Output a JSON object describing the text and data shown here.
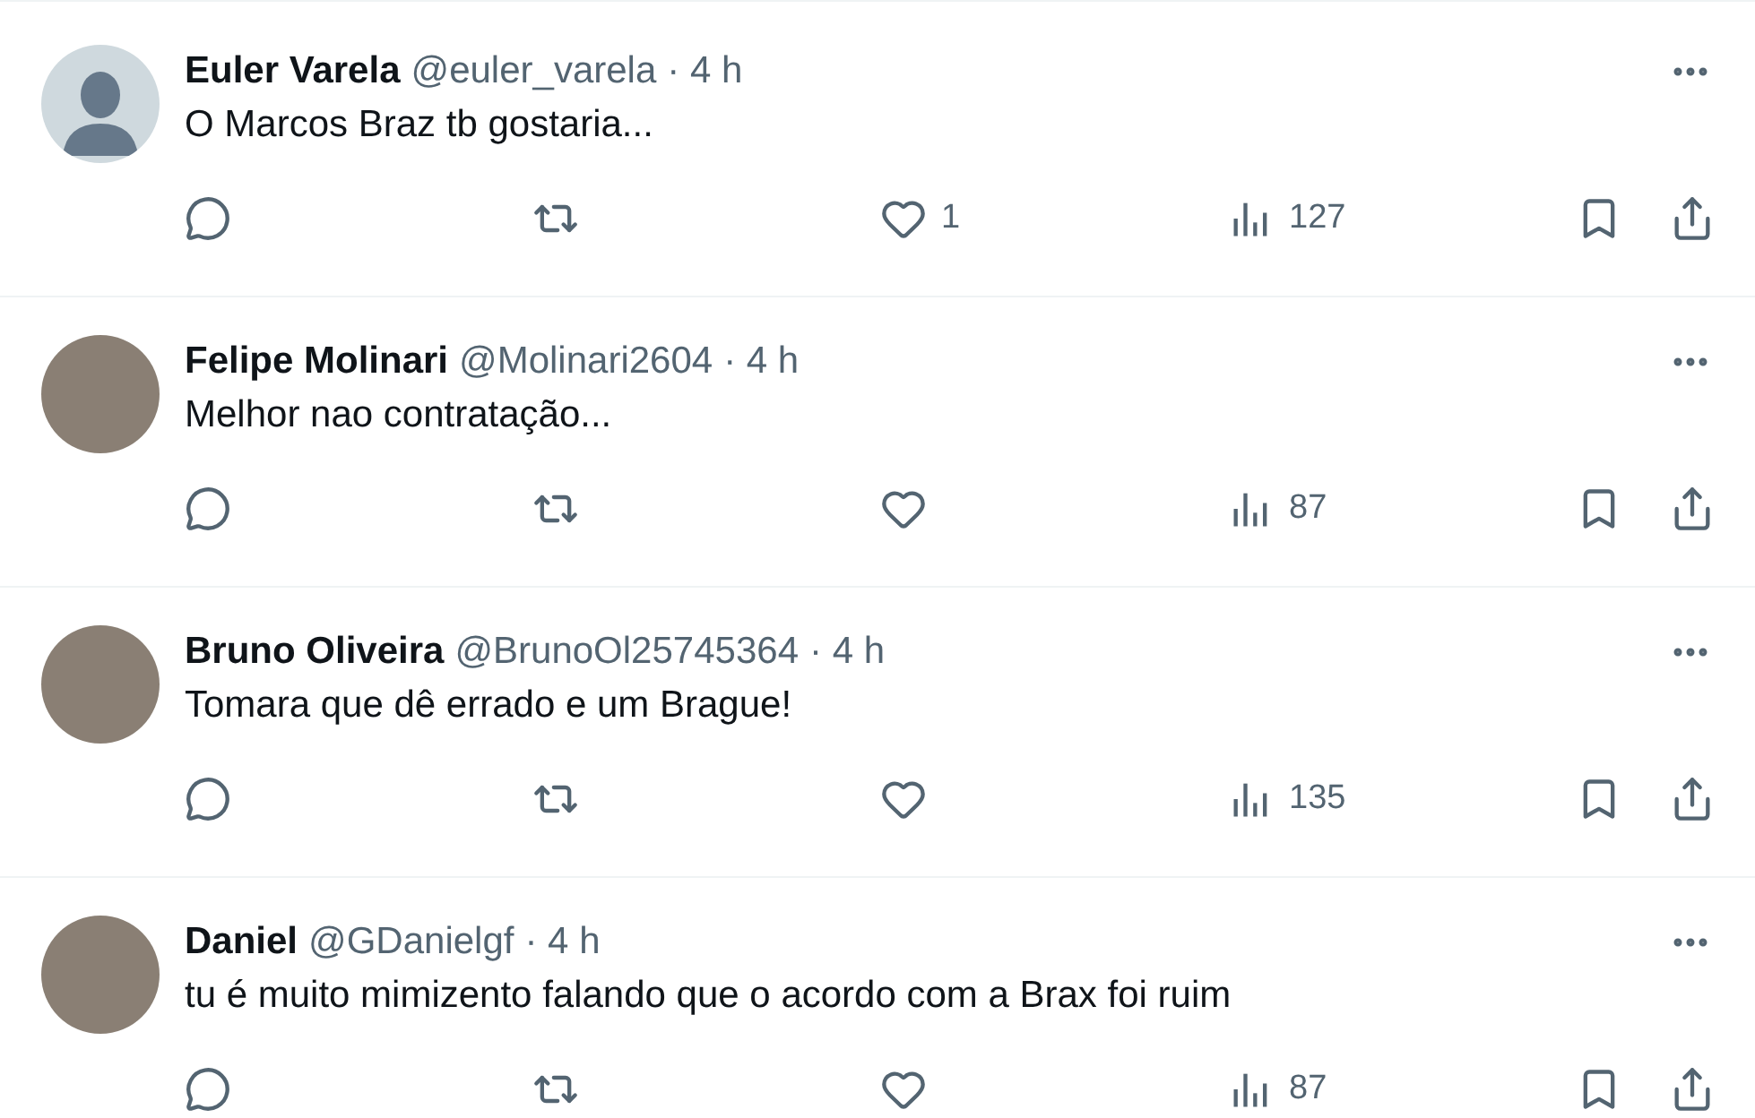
{
  "replies": [
    {
      "avatar": {
        "kind": "default"
      },
      "name": "Euler Varela",
      "handle": "@euler_varela",
      "time": "· 4 h",
      "text": "O Marcos Braz tb gostaria...",
      "likes": "1",
      "views": "127"
    },
    {
      "avatar": {
        "kind": "photo"
      },
      "name": "Felipe Molinari",
      "handle": "@Molinari2604",
      "time": "· 4 h",
      "text": "Melhor nao contratação...",
      "views": "87"
    },
    {
      "avatar": {
        "kind": "photo"
      },
      "name": "Bruno Oliveira",
      "handle": "@BrunoOl25745364",
      "time": "· 4 h",
      "text": "Tomara que dê errado e um Brague!",
      "views": "135"
    },
    {
      "avatar": {
        "kind": "photo"
      },
      "name": "Daniel",
      "handle": "@GDanielgf",
      "time": "· 4 h",
      "text": "tu é muito mimizento falando que o acordo com a Brax foi ruim",
      "views": "87"
    }
  ]
}
